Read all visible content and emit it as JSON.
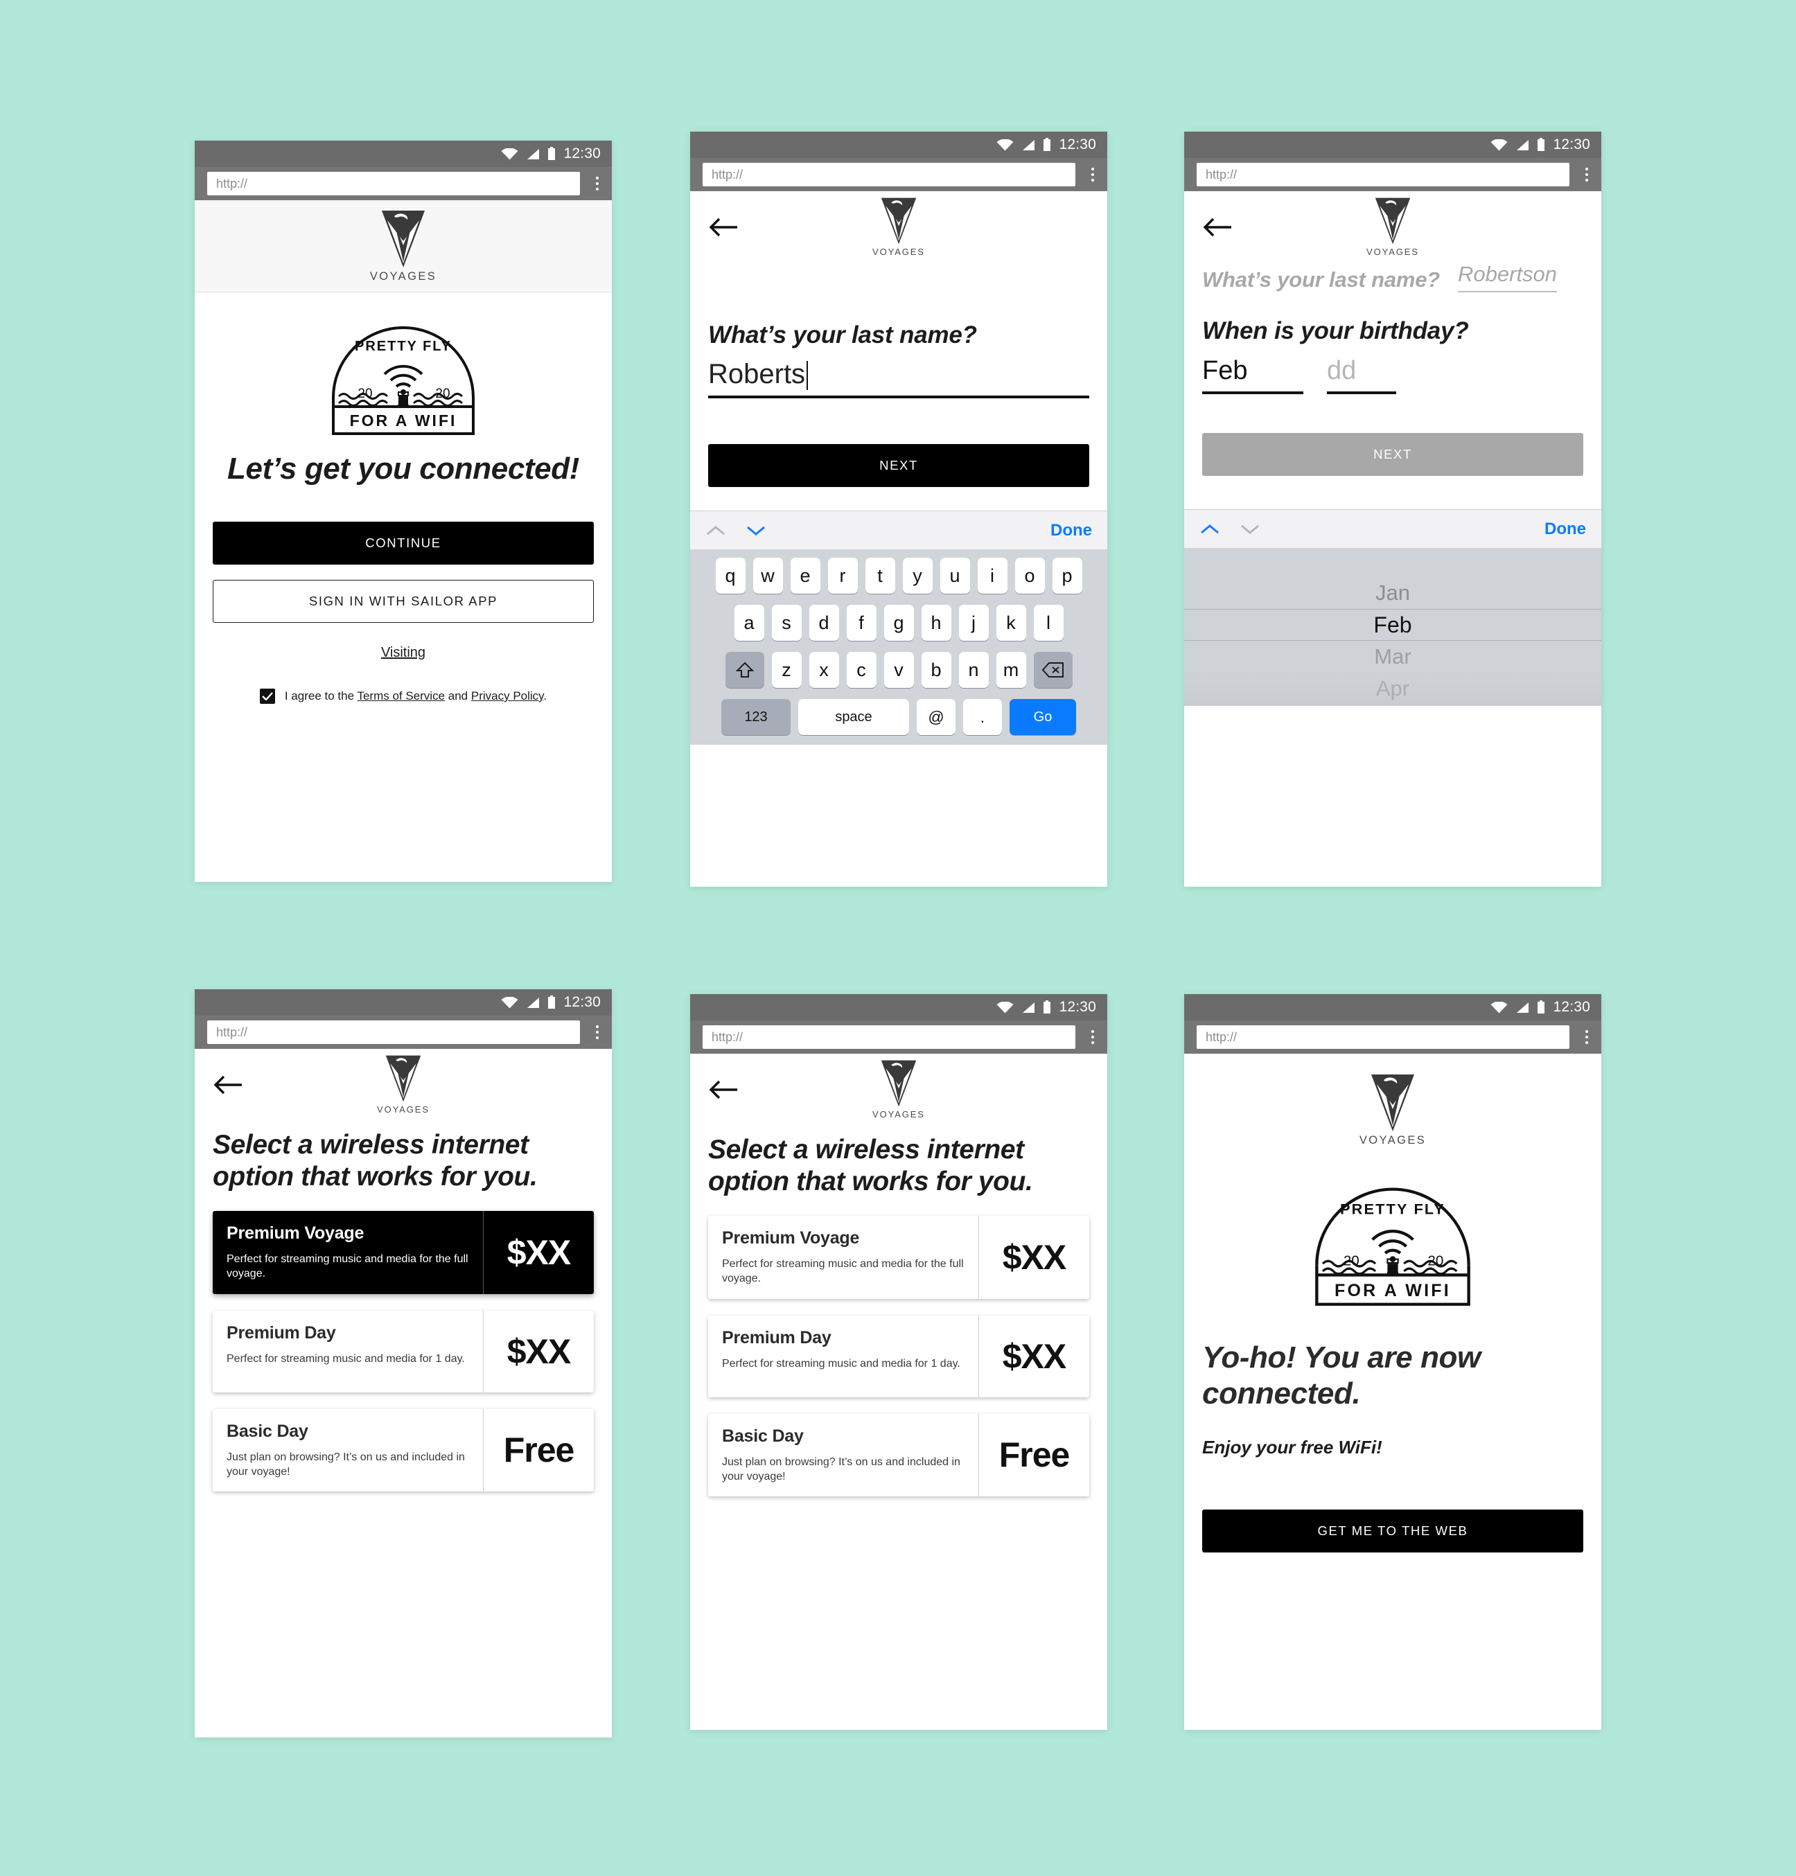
{
  "background_color": "#b1e8d8",
  "status_bar": {
    "time": "12:30",
    "icons": [
      "wifi-icon",
      "signal-icon",
      "battery-icon"
    ]
  },
  "browser_bar": {
    "url_placeholder": "http://",
    "menu_icon": "kebab-menu-icon"
  },
  "brand": {
    "wordmark": "VOYAGES",
    "mark": "virgin-triangle-logo"
  },
  "emblem": {
    "arc_top": "PRETTY FLY",
    "year_left": "20",
    "year_right": "20",
    "banner": "FOR A WIFI"
  },
  "screen1": {
    "headline": "Let’s get you connected!",
    "continue_label": "CONTINUE",
    "sailor_label": "SIGN IN WITH SAILOR APP",
    "visiting_label": "Visiting",
    "terms_prefix": "I agree to the ",
    "terms_link": "Terms of Service",
    "terms_mid": " and ",
    "privacy_link": "Privacy Policy",
    "terms_suffix": "."
  },
  "screen2": {
    "question": "What’s your last name?",
    "value": "Roberts",
    "next_label": "NEXT",
    "keyboard": {
      "done_label": "Done",
      "up_icon": "chevron-up-icon",
      "down_icon": "chevron-down-icon",
      "row1": [
        "q",
        "w",
        "e",
        "r",
        "t",
        "y",
        "u",
        "i",
        "o",
        "p"
      ],
      "row2": [
        "a",
        "s",
        "d",
        "f",
        "g",
        "h",
        "j",
        "k",
        "l"
      ],
      "row3": [
        "z",
        "x",
        "c",
        "v",
        "b",
        "n",
        "m"
      ],
      "shift_icon": "shift-key-icon",
      "backspace_icon": "backspace-key-icon",
      "num_label": "123",
      "space_label": "space",
      "at_label": "@",
      "period_label": ".",
      "go_label": "Go"
    }
  },
  "screen3": {
    "answered_question": "What’s your last name?",
    "answered_value": "Robertson",
    "question": "When is your birthday?",
    "month_value": "Feb",
    "day_placeholder": "dd",
    "next_label": "NEXT",
    "picker": {
      "done_label": "Done",
      "up_icon": "chevron-up-icon",
      "down_icon": "chevron-down-icon",
      "options": [
        "Jan",
        "Feb",
        "Mar",
        "Apr"
      ],
      "selected": "Feb"
    }
  },
  "screen4": {
    "headline": "Select a wireless internet option that works for you.",
    "plans": [
      {
        "name": "Premium Voyage",
        "desc": "Perfect for streaming music and media for the full voyage.",
        "price": "$XX",
        "selected": true
      },
      {
        "name": "Premium Day",
        "desc": "Perfect for streaming music and media for 1 day.",
        "price": "$XX",
        "selected": false
      },
      {
        "name": "Basic Day",
        "desc": "Just plan on browsing? It’s on us and included in your voyage!",
        "price": "Free",
        "selected": false
      }
    ]
  },
  "screen5": {
    "headline": "Select a wireless internet option that works for you.",
    "plans": [
      {
        "name": "Premium Voyage",
        "desc": "Perfect for streaming music and media for the full voyage.",
        "price": "$XX",
        "selected": false
      },
      {
        "name": "Premium Day",
        "desc": "Perfect for streaming music and media for 1 day.",
        "price": "$XX",
        "selected": false
      },
      {
        "name": "Basic Day",
        "desc": "Just plan on browsing? It’s on us and included in your voyage!",
        "price": "Free",
        "selected": false
      }
    ]
  },
  "screen6": {
    "headline": "Yo-ho! You are now connected.",
    "subline": "Enjoy your free WiFi!",
    "cta_label": "GET ME TO THE WEB"
  }
}
